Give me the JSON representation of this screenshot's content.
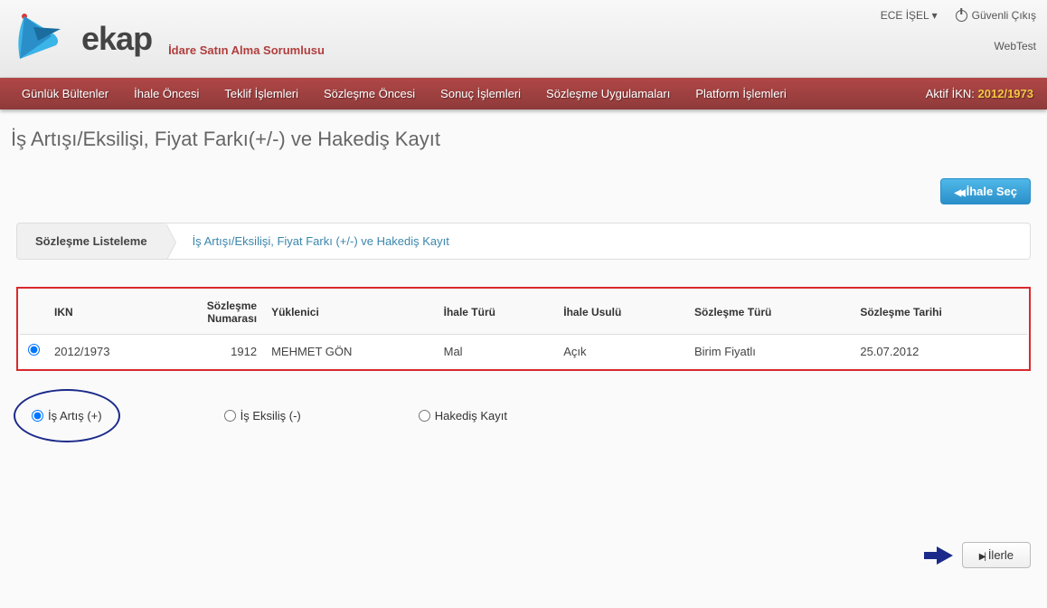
{
  "header": {
    "logo_text": "ekap",
    "subtitle": "İdare Satın Alma Sorumlusu",
    "user_name": "ECE İŞEL",
    "dropdown_symbol": "▾",
    "logout_label": "Güvenli Çıkış",
    "env_label": "WebTest"
  },
  "navbar": {
    "items": [
      "Günlük Bültenler",
      "İhale Öncesi",
      "Teklif İşlemleri",
      "Sözleşme Öncesi",
      "Sonuç İşlemleri",
      "Sözleşme Uygulamaları",
      "Platform İşlemleri"
    ],
    "active_ikn_label": "Aktif İKN:",
    "active_ikn_value": "2012/1973"
  },
  "page": {
    "title": "İş Artışı/Eksilişi, Fiyat Farkı(+/-) ve Hakediş Kayıt"
  },
  "actions": {
    "ihale_sec": "İhale Seç"
  },
  "breadcrumb": {
    "items": [
      {
        "label": "Sözleşme Listeleme",
        "active": true
      },
      {
        "label": "İş Artışı/Eksilişi, Fiyat Farkı (+/-) ve Hakediş Kayıt",
        "active": false
      }
    ]
  },
  "table": {
    "headers": {
      "ikn": "IKN",
      "sozlesme_no": "Sözleşme Numarası",
      "yuklenici": "Yüklenici",
      "ihale_turu": "İhale Türü",
      "ihale_usulu": "İhale Usulü",
      "sozlesme_turu": "Sözleşme Türü",
      "sozlesme_tarihi": "Sözleşme Tarihi"
    },
    "rows": [
      {
        "selected": true,
        "ikn": "2012/1973",
        "sozlesme_no": "1912",
        "yuklenici": "MEHMET GÖN",
        "ihale_turu": "Mal",
        "ihale_usulu": "Açık",
        "sozlesme_turu": "Birim Fiyatlı",
        "sozlesme_tarihi": "25.07.2012"
      }
    ]
  },
  "options": {
    "is_artis": "İş Artış (+)",
    "is_eksilis": "İş Eksiliş (-)",
    "hakedis_kayit": "Hakediş Kayıt"
  },
  "footer": {
    "ilerle": "İlerle"
  }
}
